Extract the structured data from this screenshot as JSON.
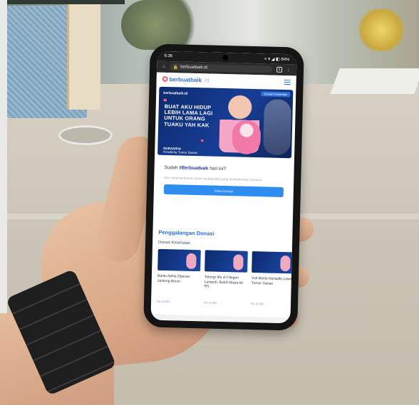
{
  "phone": {
    "status_time": "6:36",
    "status_icons": "⋄ ▾ ◢ ◧ 84%",
    "url": "berbuatbaik.id",
    "tab_count": "8"
  },
  "site": {
    "logo_name": "berbuatbaik",
    "logo_tld": ".id"
  },
  "banner": {
    "logo": "berbuatbaik.id",
    "tag": "Donasi Kesehatan",
    "open_quote": "❝",
    "headline": "BUAT AKU HIDUP LEBIH LAMA LAGI UNTUK ORANG TUAKU YAH KAK",
    "close_quote": "❞",
    "person_name": "NURADIFIA",
    "person_desc": "Penderita Tumor Ganas"
  },
  "invite": {
    "prefix": "Sudah ",
    "hashtag": "#Berbuatbaik",
    "suffix": " hari ini?",
    "description": "Ayo mulai berdonasi untuk saudara kita yang membutuhkan bantuan",
    "cta_label": "Mulai Donasi"
  },
  "fundraising": {
    "section_title": "Penggalangan Donasi",
    "category": "Donasi Kesehatan",
    "cards": [
      {
        "title": "Bantu Aditia Operasi Jantung Bocor",
        "amount": "Rp 10.000"
      },
      {
        "title": "Tolong! Ibu di Cilegon Lumpuh, Butuh Biaya ke RS",
        "amount": "Rp 10.000"
      },
      {
        "title": "Yuk Bantu Nuraqifa Lawan Tumor Ganas",
        "amount": "Rp 10.000"
      }
    ]
  }
}
